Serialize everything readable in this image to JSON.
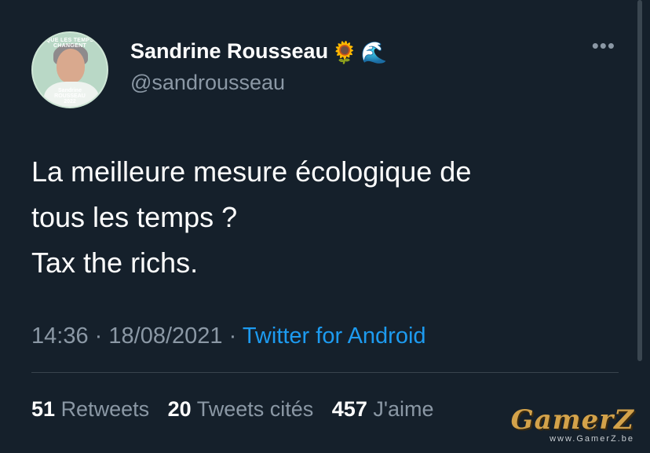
{
  "author": {
    "name": "Sandrine Rousseau",
    "handle": "@sandrousseau",
    "emojis": [
      "🌻",
      "🌊"
    ],
    "avatar_ring_text": "QUE LES TEMPS CHANGENT",
    "avatar_stamp": [
      "Sandrine",
      "ROUSSEAU",
      "2022"
    ]
  },
  "menu_icon": "more-dots-icon",
  "tweet": {
    "lines": [
      "La meilleure mesure écologique de",
      "tous les temps ?",
      "Tax the richs."
    ]
  },
  "meta": {
    "time": "14:36",
    "sep1": "·",
    "date": "18/08/2021",
    "sep2": "·",
    "source": "Twitter for Android"
  },
  "stats": {
    "retweets_count": "51",
    "retweets_label": "Retweets",
    "quotes_count": "20",
    "quotes_label": "Tweets cités",
    "likes_count": "457",
    "likes_label": "J'aime"
  },
  "watermark": {
    "logo": "GamerZ",
    "url": "www.GamerZ.be"
  },
  "colors": {
    "background": "#15202b",
    "text": "#ffffff",
    "secondary": "#8b98a5",
    "link": "#1d9bf0",
    "divider": "#38444d"
  }
}
